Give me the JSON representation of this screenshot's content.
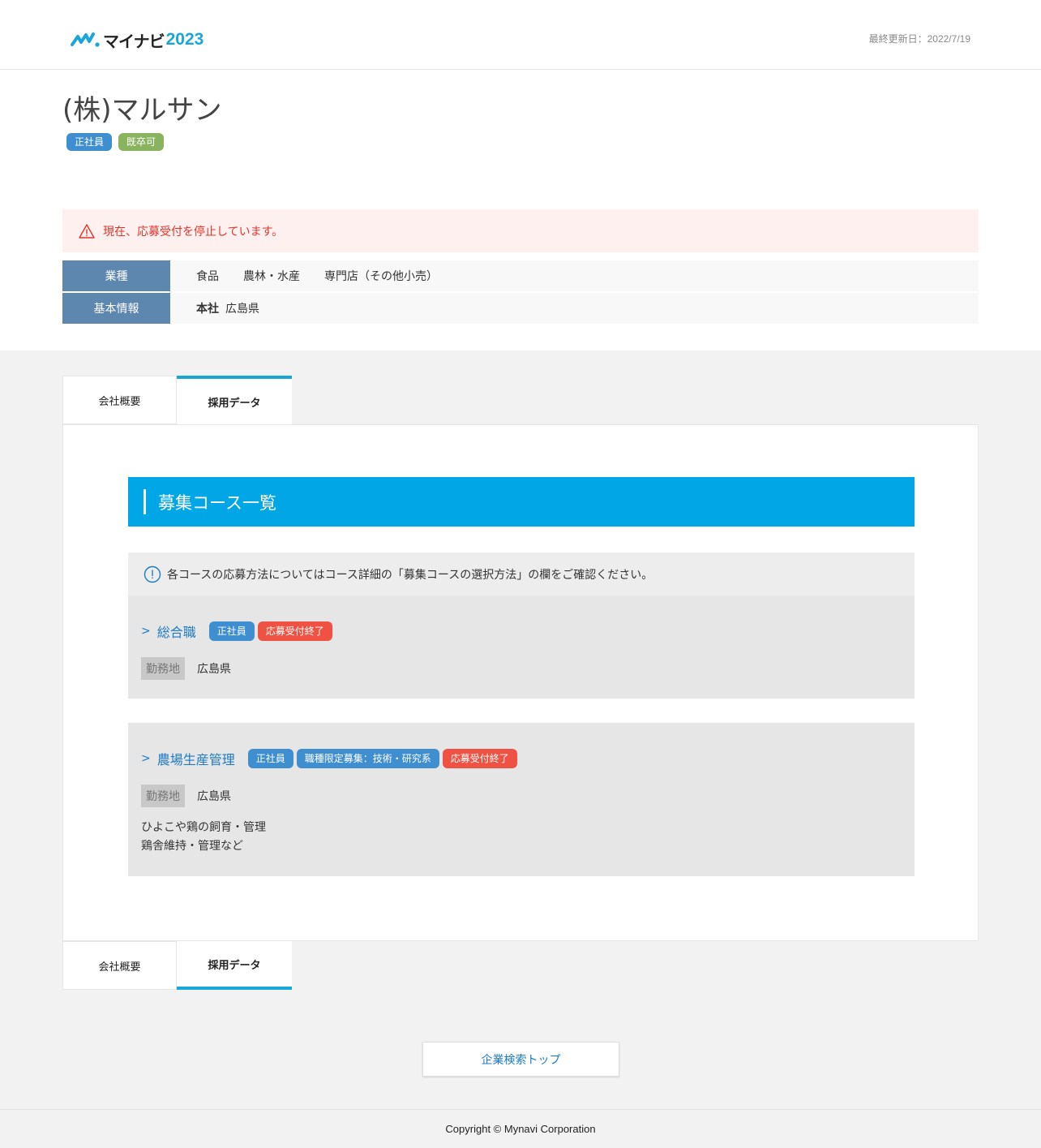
{
  "header": {
    "logo_text": "マイナビ",
    "logo_year": "2023",
    "updated": "最終更新日：2022/7/19"
  },
  "company": {
    "name": "(株)マルサン",
    "tags": [
      "正社員",
      "既卒可"
    ]
  },
  "alert": {
    "text": "現在、応募受付を停止しています。"
  },
  "info": {
    "industry_label": "業種",
    "industries": [
      "食品",
      "農林・水産",
      "専門店（その他小売）"
    ],
    "basic_label": "基本情報",
    "hq_label": "本社",
    "hq_value": "広島県"
  },
  "tabs": {
    "company": "会社概要",
    "recruit": "採用データ"
  },
  "section": {
    "title": "募集コース一覧",
    "notice": "各コースの応募方法についてはコース詳細の「募集コースの選択方法」の欄をご確認ください。"
  },
  "courses": [
    {
      "title": "総合職",
      "tags": [
        "正社員",
        "応募受付終了"
      ],
      "loc_label": "勤務地",
      "loc_value": "広島県"
    },
    {
      "title": "農場生産管理",
      "tags": [
        "正社員",
        "職種限定募集：技術・研究系",
        "応募受付終了"
      ],
      "loc_label": "勤務地",
      "loc_value": "広島県",
      "desc1": "ひよこや鶏の飼育・管理",
      "desc2": "鶏舎維持・管理など"
    }
  ],
  "buttons": {
    "search_top": "企業検索トップ"
  },
  "footer": {
    "copyright": "Copyright © Mynavi Corporation"
  },
  "colors": {
    "accent": "#00a6e6",
    "tag_blue": "#3e8ed0",
    "tag_green": "#8ab360",
    "tag_red": "#ef5143",
    "alert_text": "#e0352b",
    "link": "#1d7bc4"
  }
}
